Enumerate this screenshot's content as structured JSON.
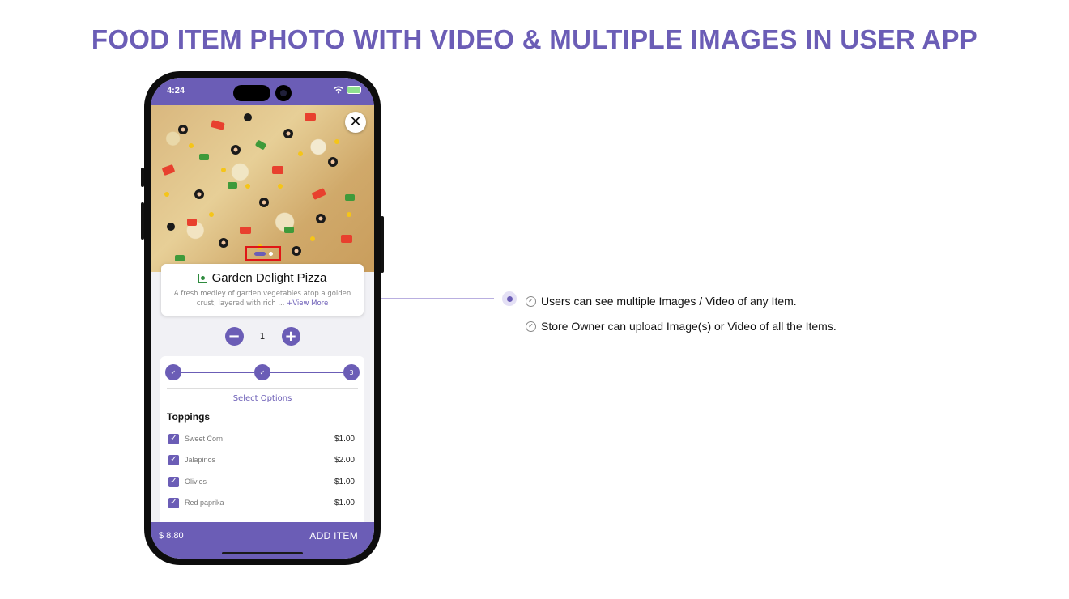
{
  "page": {
    "title": "FOOD ITEM PHOTO WITH VIDEO & MULTIPLE IMAGES IN USER APP"
  },
  "status_bar": {
    "time": "4:24"
  },
  "item": {
    "name": "Garden Delight Pizza",
    "description": "A fresh medley of garden vegetables atop a golden crust, layered with rich ...",
    "view_more": "+View More",
    "close_icon": "close-icon",
    "veg_icon": "veg-indicator-icon"
  },
  "quantity": {
    "value": "1",
    "minus": "−",
    "plus": "+"
  },
  "options": {
    "steps": [
      "✓",
      "✓",
      "3"
    ],
    "select_label": "Select Options",
    "section_title": "Toppings",
    "toppings": [
      {
        "name": "Sweet Corn",
        "price": "$1.00",
        "checked": true
      },
      {
        "name": "Jalapinos",
        "price": "$2.00",
        "checked": true
      },
      {
        "name": "Olivies",
        "price": "$1.00",
        "checked": true
      },
      {
        "name": "Red paprika",
        "price": "$1.00",
        "checked": true
      }
    ]
  },
  "bottom_bar": {
    "total": "$ 8.80",
    "add_label": "ADD ITEM"
  },
  "features": [
    "Users can see multiple Images / Video of any Item.",
    "Store Owner can upload Image(s) or Video of all the Items."
  ],
  "colors": {
    "accent": "#6b5db6",
    "highlight": "#e01616",
    "veg": "#2e8b3e"
  }
}
